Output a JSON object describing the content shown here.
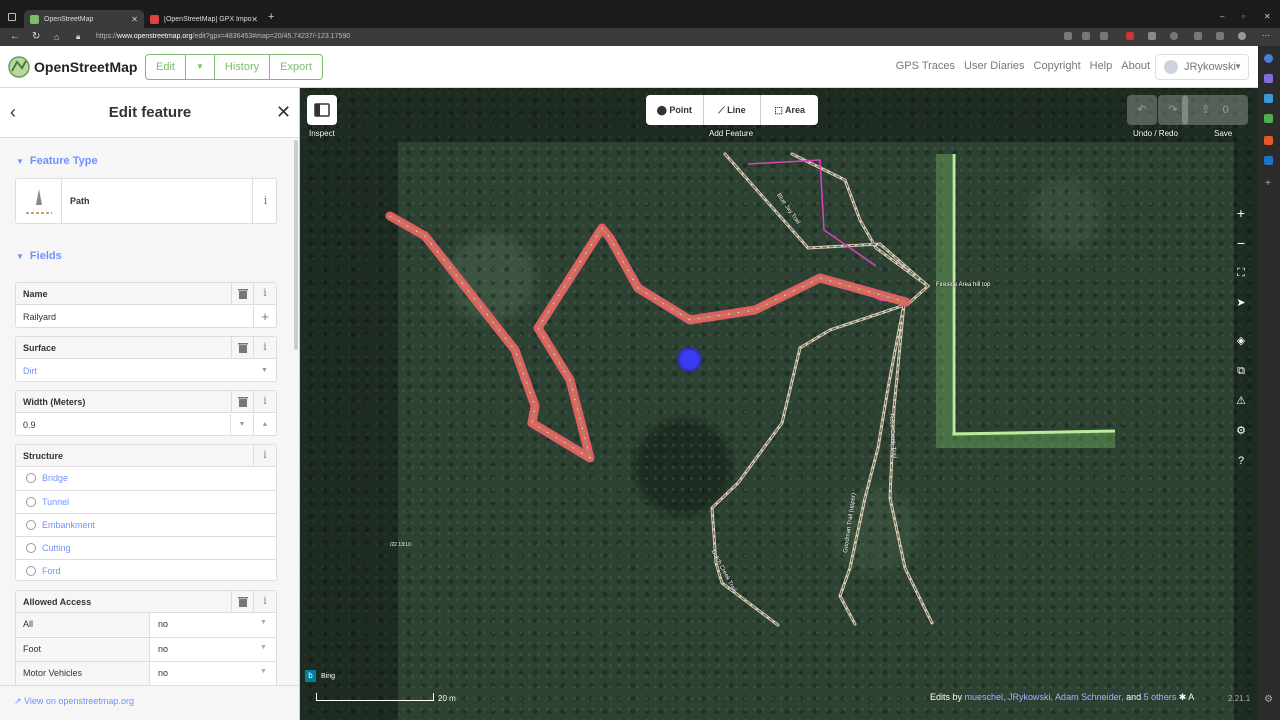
{
  "browser": {
    "tabs": [
      {
        "title": "OpenStreetMap",
        "active": true
      },
      {
        "title": "[OpenStreetMap] GPX Import su...",
        "active": false
      }
    ],
    "url_prefix": "https://",
    "url_host": "www.openstreetmap.org",
    "url_path": "/edit?gpx=4836453#map=20/45.74237/-123.17590"
  },
  "header": {
    "brand": "OpenStreetMap",
    "edit": "Edit",
    "history": "History",
    "export": "Export",
    "links": [
      "GPS Traces",
      "User Diaries",
      "Copyright",
      "Help",
      "About"
    ],
    "user": "JRykowski"
  },
  "sidebar": {
    "title": "Edit feature",
    "feature_type_section": "Feature Type",
    "preset_name": "Path",
    "fields_section": "Fields",
    "name_label": "Name",
    "name_value": "Railyard",
    "surface_label": "Surface",
    "surface_value": "Dirt",
    "width_label": "Width (Meters)",
    "width_value": "0.9",
    "structure_label": "Structure",
    "structure_options": [
      "Bridge",
      "Tunnel",
      "Embankment",
      "Cutting",
      "Ford"
    ],
    "access_label": "Allowed Access",
    "access_rows": [
      {
        "key": "All",
        "value": "no"
      },
      {
        "key": "Foot",
        "value": "no"
      },
      {
        "key": "Motor Vehicles",
        "value": "no"
      }
    ],
    "view_link": "View on openstreetmap.org"
  },
  "map": {
    "inspect_label": "Inspect",
    "add_point": "Point",
    "add_line": "Line",
    "add_area": "Area",
    "add_feature_label": "Add Feature",
    "undo_redo_label": "Undo / Redo",
    "save_label": "Save",
    "save_count": "0",
    "scale_label": "20 m",
    "imagery": "Bing",
    "timestamp": "/22 13:10",
    "road_labels": [
      "Blue Jay Trail",
      "Fireside Area hill top",
      "Dutch Creek Trail",
      "Goodman Trail (upper)",
      "Rock Creek Trail"
    ],
    "edits_prefix": "Edits by",
    "edit_users": "mueschel, JRykowski, Adam Schneider,",
    "edits_and": "and",
    "edits_others": "5 others",
    "version": "2.21.1"
  },
  "colors": {
    "osm_green": "#7ebc6f",
    "link_blue": "#7092ff",
    "selected_path": "#e8606a",
    "gpx_track": "#e040c0"
  }
}
